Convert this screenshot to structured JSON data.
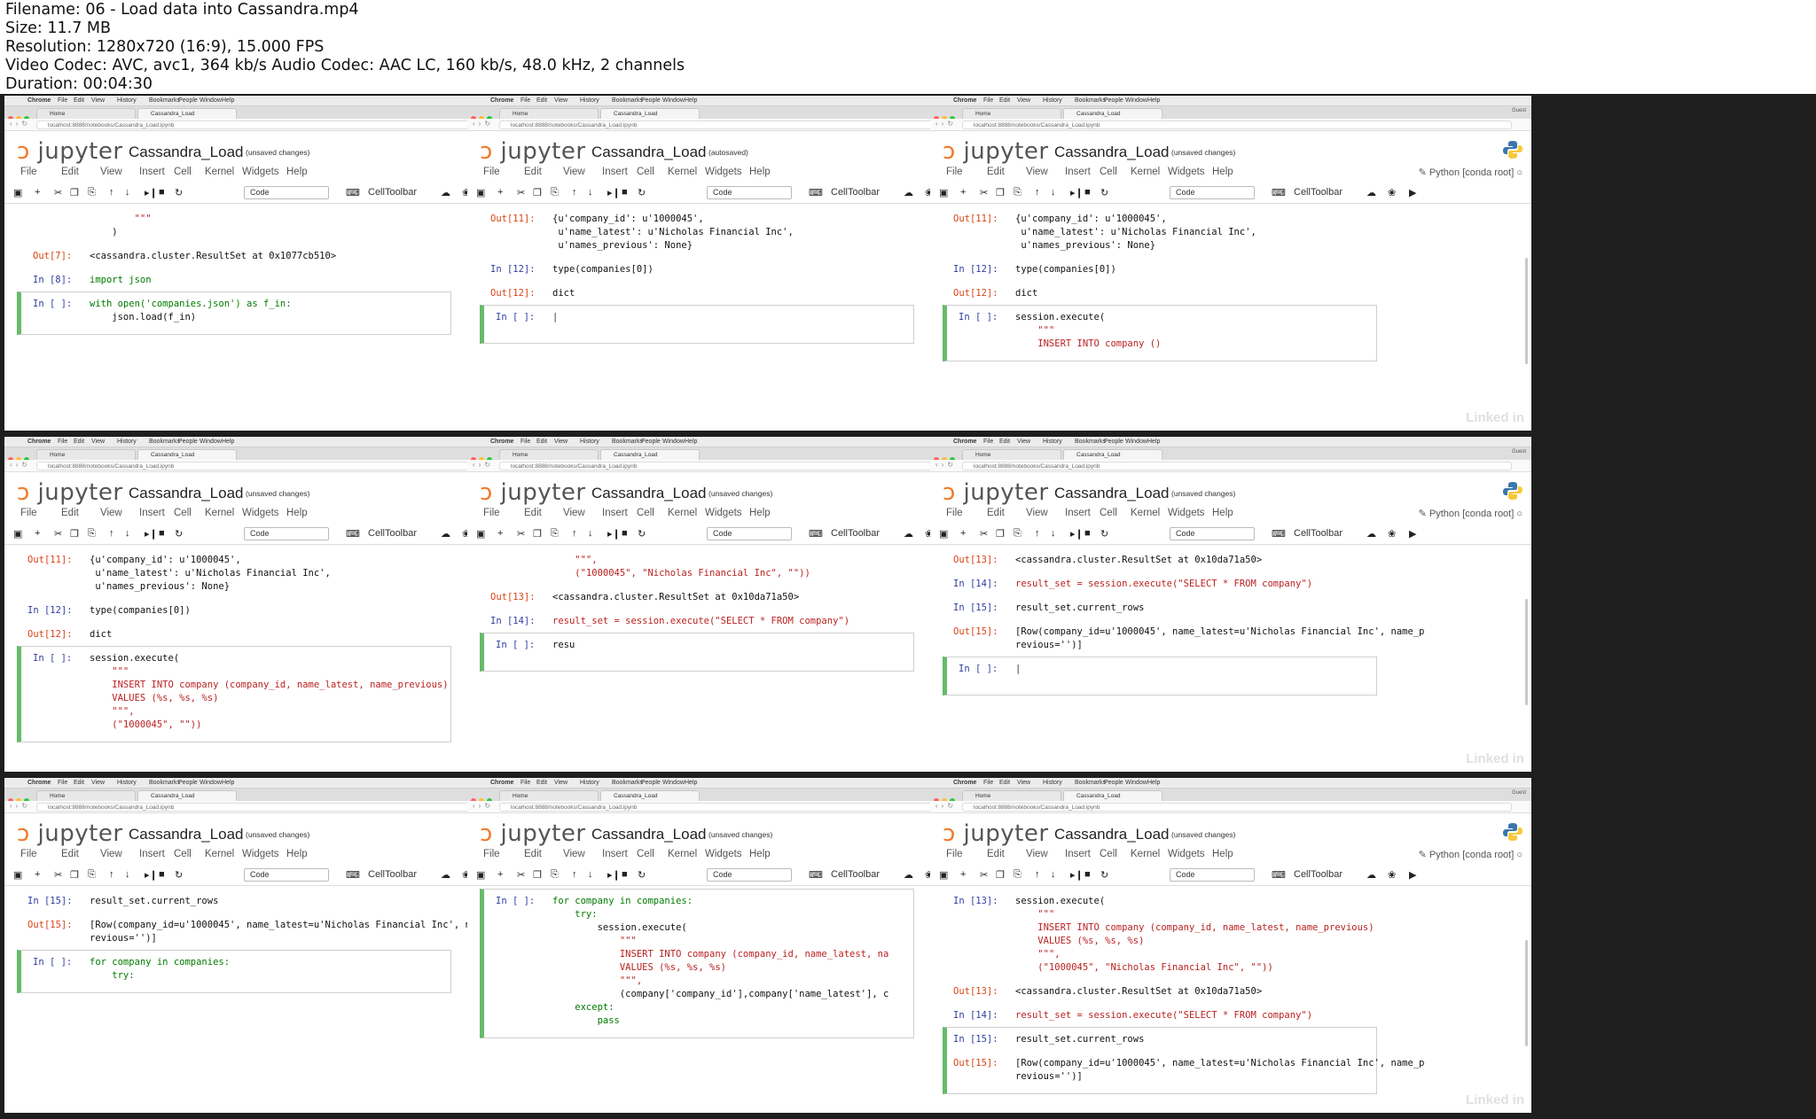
{
  "meta": {
    "lines": [
      "Filename: 06 - Load data into Cassandra.mp4",
      "Size: 11.7 MB",
      "Resolution: 1280x720 (16:9), 15.000 FPS",
      "Video Codec: AVC, avc1, 364 kb/s Audio Codec: AAC LC, 160 kb/s, 48.0 kHz, 2 channels",
      "Duration: 00:04:30"
    ]
  },
  "chrome": {
    "menubar": [
      "Chrome",
      "File",
      "Edit",
      "View",
      "History",
      "Bookmarks",
      "People",
      "Window",
      "Help"
    ],
    "tab_home": "Home",
    "tab_nb": "Cassandra_Load",
    "guest": "Guest",
    "url": "localhost:8888/notebooks/Cassandra_Load.ipynb"
  },
  "jupyter": {
    "logo": "jupyter",
    "notebook": "Cassandra_Load",
    "menu": [
      "File",
      "Edit",
      "View",
      "Insert",
      "Cell",
      "Kernel",
      "Widgets",
      "Help"
    ],
    "kernel": "Python [conda root]",
    "celltype": "Code",
    "celltoolbar": "CellToolbar",
    "watermark": "Linked in"
  },
  "colors": {
    "accent_orange": "#f37726",
    "cell_green": "#66bb6a",
    "prompt_in": "#303f9f",
    "prompt_out": "#d84315",
    "string": "#ba2121",
    "keyword": "#008000"
  },
  "thumbs": [
    {
      "status": "(unsaved changes)",
      "lines": [
        {
          "p": "",
          "t": "        \"\"\""
        },
        {
          "p": "",
          "t": "    )"
        },
        {
          "p": "Out[7]:",
          "t": "<cassandra.cluster.ResultSet at 0x1077cb510>"
        },
        {
          "p": "In [8]:",
          "t": "import json"
        },
        {
          "p": "In [ ]:",
          "t": "with open('companies.json') as f_in:"
        },
        {
          "p": "",
          "t": "    json.load(f_in)"
        }
      ]
    },
    {
      "status": "(autosaved)",
      "lines": [
        {
          "p": "Out[11]:",
          "t": "{u'company_id': u'1000045',"
        },
        {
          "p": "",
          "t": " u'name_latest': u'Nicholas Financial Inc',"
        },
        {
          "p": "",
          "t": " u'names_previous': None}"
        },
        {
          "p": "In [12]:",
          "t": "type(companies[0])"
        },
        {
          "p": "Out[12]:",
          "t": "dict"
        },
        {
          "p": "In [ ]:",
          "t": ""
        }
      ]
    },
    {
      "status": "(unsaved changes)",
      "lines": [
        {
          "p": "Out[11]:",
          "t": "{u'company_id': u'1000045',"
        },
        {
          "p": "",
          "t": " u'name_latest': u'Nicholas Financial Inc',"
        },
        {
          "p": "",
          "t": " u'names_previous': None}"
        },
        {
          "p": "In [12]:",
          "t": "type(companies[0])"
        },
        {
          "p": "Out[12]:",
          "t": "dict"
        },
        {
          "p": "In [ ]:",
          "t": "session.execute("
        },
        {
          "p": "",
          "t": "    \"\"\""
        },
        {
          "p": "",
          "t": "    INSERT INTO company ()"
        }
      ]
    },
    {
      "status": "(unsaved changes)",
      "lines": [
        {
          "p": "Out[11]:",
          "t": "{u'company_id': u'1000045',"
        },
        {
          "p": "",
          "t": " u'name_latest': u'Nicholas Financial Inc',"
        },
        {
          "p": "",
          "t": " u'names_previous': None}"
        },
        {
          "p": "In [12]:",
          "t": "type(companies[0])"
        },
        {
          "p": "Out[12]:",
          "t": "dict"
        },
        {
          "p": "In [ ]:",
          "t": "session.execute("
        },
        {
          "p": "",
          "t": "    \"\"\""
        },
        {
          "p": "",
          "t": "    INSERT INTO company (company_id, name_latest, name_previous)"
        },
        {
          "p": "",
          "t": "    VALUES (%s, %s, %s)"
        },
        {
          "p": "",
          "t": "    \"\"\","
        },
        {
          "p": "",
          "t": "    (\"1000045\", \"\"))"
        }
      ]
    },
    {
      "status": "(unsaved changes)",
      "lines": [
        {
          "p": "",
          "t": "    \"\"\","
        },
        {
          "p": "",
          "t": "    (\"1000045\", \"Nicholas Financial Inc\", \"\"))"
        },
        {
          "p": "Out[13]:",
          "t": "<cassandra.cluster.ResultSet at 0x10da71a50>"
        },
        {
          "p": "In [14]:",
          "t": "result_set = session.execute(\"SELECT * FROM company\")"
        },
        {
          "p": "In [ ]:",
          "t": "resu"
        }
      ]
    },
    {
      "status": "(unsaved changes)",
      "lines": [
        {
          "p": "Out[13]:",
          "t": "<cassandra.cluster.ResultSet at 0x10da71a50>"
        },
        {
          "p": "In [14]:",
          "t": "result_set = session.execute(\"SELECT * FROM company\")"
        },
        {
          "p": "In [15]:",
          "t": "result_set.current_rows"
        },
        {
          "p": "Out[15]:",
          "t": "[Row(company_id=u'1000045', name_latest=u'Nicholas Financial Inc', name_p"
        },
        {
          "p": "",
          "t": "revious='')]"
        },
        {
          "p": "In [ ]:",
          "t": ""
        }
      ]
    },
    {
      "status": "(unsaved changes)",
      "lines": [
        {
          "p": "In [15]:",
          "t": "result_set.current_rows"
        },
        {
          "p": "Out[15]:",
          "t": "[Row(company_id=u'1000045', name_latest=u'Nicholas Financial Inc', name_p"
        },
        {
          "p": "",
          "t": "revious='')]"
        },
        {
          "p": "In [ ]:",
          "t": "for company in companies:"
        },
        {
          "p": "",
          "t": "    try:"
        }
      ]
    },
    {
      "status": "(unsaved changes)",
      "lines": [
        {
          "p": "In [ ]:",
          "t": "for company in companies:"
        },
        {
          "p": "",
          "t": "    try:"
        },
        {
          "p": "",
          "t": "        session.execute("
        },
        {
          "p": "",
          "t": "            \"\"\""
        },
        {
          "p": "",
          "t": "            INSERT INTO company (company_id, name_latest, na"
        },
        {
          "p": "",
          "t": "            VALUES (%s, %s, %s)"
        },
        {
          "p": "",
          "t": "            \"\"\","
        },
        {
          "p": "",
          "t": "            (company['company_id'],company['name_latest'], c"
        },
        {
          "p": "",
          "t": "    except:"
        },
        {
          "p": "",
          "t": "        pass"
        }
      ]
    },
    {
      "status": "(unsaved changes)",
      "lines": [
        {
          "p": "In [13]:",
          "t": "session.execute("
        },
        {
          "p": "",
          "t": "    \"\"\""
        },
        {
          "p": "",
          "t": "    INSERT INTO company (company_id, name_latest, name_previous)"
        },
        {
          "p": "",
          "t": "    VALUES (%s, %s, %s)"
        },
        {
          "p": "",
          "t": "    \"\"\","
        },
        {
          "p": "",
          "t": "    (\"1000045\", \"Nicholas Financial Inc\", \"\"))"
        },
        {
          "p": "Out[13]:",
          "t": "<cassandra.cluster.ResultSet at 0x10da71a50>"
        },
        {
          "p": "In [14]:",
          "t": "result_set = session.execute(\"SELECT * FROM company\")"
        },
        {
          "p": "In [15]:",
          "t": "result_set.current_rows"
        },
        {
          "p": "Out[15]:",
          "t": "[Row(company_id=u'1000045', name_latest=u'Nicholas Financial Inc', name_p"
        },
        {
          "p": "",
          "t": "revious='')]"
        }
      ]
    }
  ]
}
